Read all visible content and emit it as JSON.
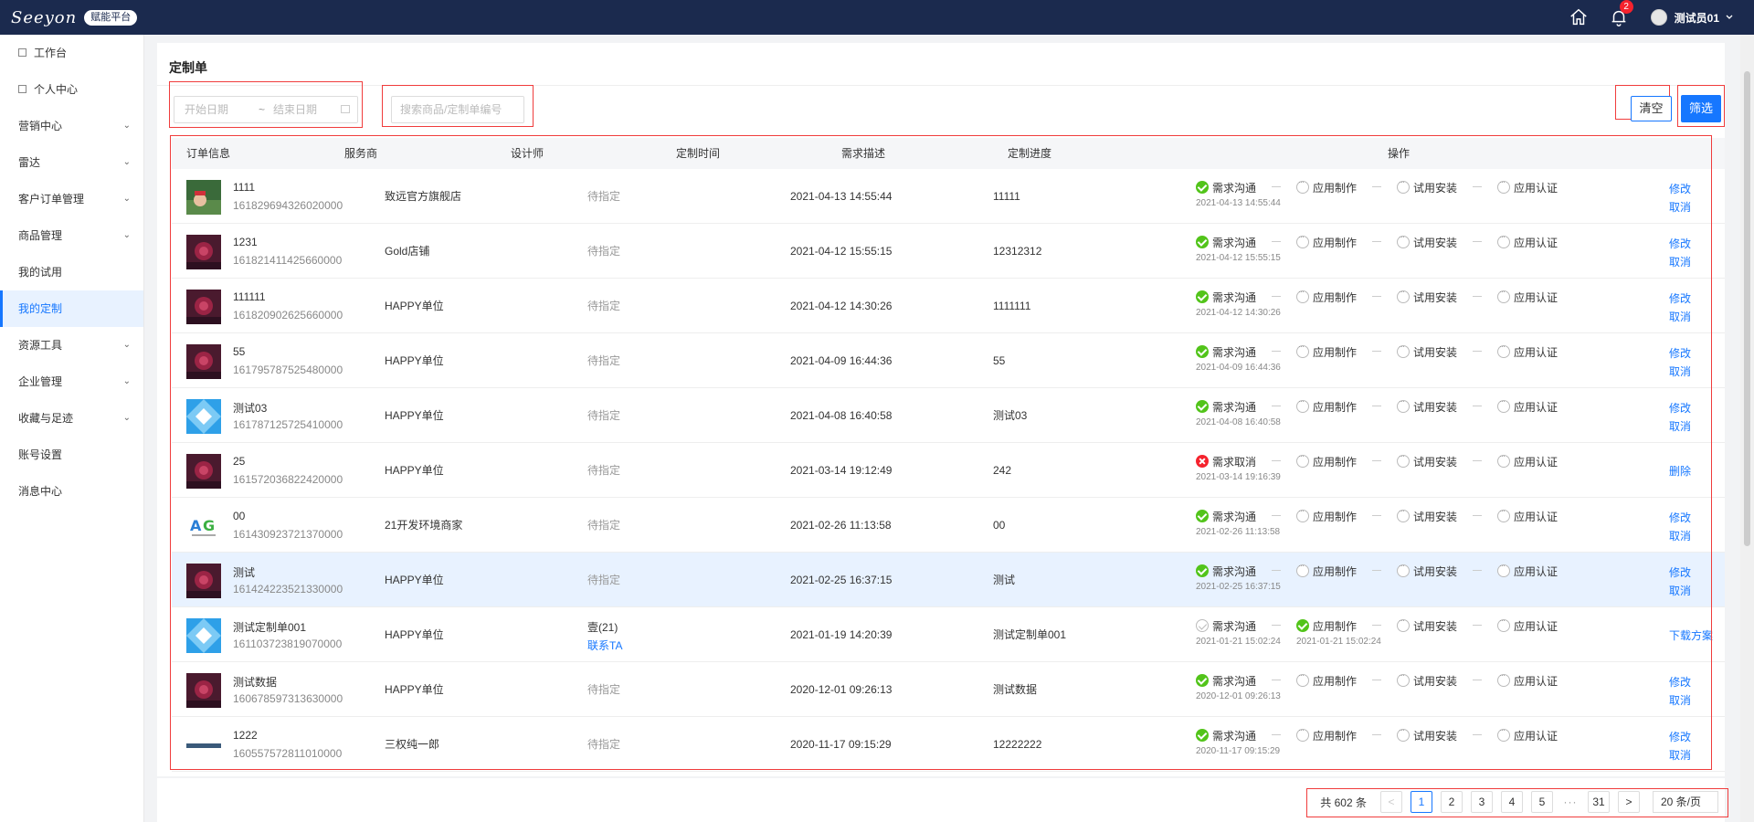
{
  "topbar": {
    "logo_text": "Seeyon",
    "logo_badge": "赋能平台",
    "notification_count": "2",
    "username": "测试员01"
  },
  "sidebar": {
    "items": [
      {
        "label": "工作台",
        "icon": "box-icon",
        "chevron": false,
        "active": false
      },
      {
        "label": "个人中心",
        "icon": "box-icon",
        "chevron": false,
        "active": false
      },
      {
        "label": "营销中心",
        "chevron": true,
        "active": false
      },
      {
        "label": "雷达",
        "chevron": true,
        "active": false
      },
      {
        "label": "客户订单管理",
        "chevron": true,
        "active": false
      },
      {
        "label": "商品管理",
        "chevron": true,
        "active": false
      },
      {
        "label": "我的试用",
        "chevron": false,
        "active": false
      },
      {
        "label": "我的定制",
        "chevron": false,
        "active": true
      },
      {
        "label": "资源工具",
        "chevron": true,
        "active": false
      },
      {
        "label": "企业管理",
        "chevron": true,
        "active": false
      },
      {
        "label": "收藏与足迹",
        "chevron": true,
        "active": false
      },
      {
        "label": "账号设置",
        "chevron": false,
        "active": false
      },
      {
        "label": "消息中心",
        "chevron": false,
        "active": false
      }
    ]
  },
  "page": {
    "title": "定制单",
    "date_start_placeholder": "开始日期",
    "date_separator": "~",
    "date_end_placeholder": "结束日期",
    "search_placeholder": "搜索商品/定制单编号",
    "clear_label": "清空",
    "filter_label": "筛选"
  },
  "table": {
    "headers": [
      "订单信息",
      "服务商",
      "设计师",
      "定制时间",
      "需求描述",
      "定制进度",
      "操作"
    ],
    "rows": [
      {
        "name": "1111",
        "no": "161829694326020000",
        "provider": "致远官方旗舰店",
        "designer": "待指定",
        "designer_link": "",
        "time": "2021-04-13 14:55:44",
        "desc": "11111",
        "thumb": "photo",
        "steps": [
          {
            "label": "需求沟通",
            "state": "done",
            "time": "2021-04-13 14:55:44"
          },
          {
            "label": "应用制作",
            "state": "pending",
            "time": ""
          },
          {
            "label": "试用安装",
            "state": "pending",
            "time": ""
          },
          {
            "label": "应用认证",
            "state": "pending",
            "time": ""
          }
        ],
        "ops": [
          "修改",
          "取消"
        ],
        "highlight": false
      },
      {
        "name": "1231",
        "no": "161821411425660000",
        "provider": "Gold店铺",
        "designer": "待指定",
        "designer_link": "",
        "time": "2021-04-12 15:55:15",
        "desc": "12312312",
        "thumb": "rose",
        "steps": [
          {
            "label": "需求沟通",
            "state": "done",
            "time": "2021-04-12 15:55:15"
          },
          {
            "label": "应用制作",
            "state": "pending",
            "time": ""
          },
          {
            "label": "试用安装",
            "state": "pending",
            "time": ""
          },
          {
            "label": "应用认证",
            "state": "pending",
            "time": ""
          }
        ],
        "ops": [
          "修改",
          "取消"
        ],
        "highlight": false
      },
      {
        "name": "111111",
        "no": "161820902625660000",
        "provider": "HAPPY单位",
        "designer": "待指定",
        "designer_link": "",
        "time": "2021-04-12 14:30:26",
        "desc": "1111111",
        "thumb": "rose",
        "steps": [
          {
            "label": "需求沟通",
            "state": "done",
            "time": "2021-04-12 14:30:26"
          },
          {
            "label": "应用制作",
            "state": "pending",
            "time": ""
          },
          {
            "label": "试用安装",
            "state": "pending",
            "time": ""
          },
          {
            "label": "应用认证",
            "state": "pending",
            "time": ""
          }
        ],
        "ops": [
          "修改",
          "取消"
        ],
        "highlight": false
      },
      {
        "name": "55",
        "no": "161795787525480000",
        "provider": "HAPPY单位",
        "designer": "待指定",
        "designer_link": "",
        "time": "2021-04-09 16:44:36",
        "desc": "55",
        "thumb": "rose",
        "steps": [
          {
            "label": "需求沟通",
            "state": "done",
            "time": "2021-04-09 16:44:36"
          },
          {
            "label": "应用制作",
            "state": "pending",
            "time": ""
          },
          {
            "label": "试用安装",
            "state": "pending",
            "time": ""
          },
          {
            "label": "应用认证",
            "state": "pending",
            "time": ""
          }
        ],
        "ops": [
          "修改",
          "取消"
        ],
        "highlight": false
      },
      {
        "name": "测试03",
        "no": "161787125725410000",
        "provider": "HAPPY单位",
        "designer": "待指定",
        "designer_link": "",
        "time": "2021-04-08 16:40:58",
        "desc": "测试03",
        "thumb": "blue",
        "steps": [
          {
            "label": "需求沟通",
            "state": "done",
            "time": "2021-04-08 16:40:58"
          },
          {
            "label": "应用制作",
            "state": "pending",
            "time": ""
          },
          {
            "label": "试用安装",
            "state": "pending",
            "time": ""
          },
          {
            "label": "应用认证",
            "state": "pending",
            "time": ""
          }
        ],
        "ops": [
          "修改",
          "取消"
        ],
        "highlight": false
      },
      {
        "name": "25",
        "no": "161572036822420000",
        "provider": "HAPPY单位",
        "designer": "待指定",
        "designer_link": "",
        "time": "2021-03-14 19:12:49",
        "desc": "242",
        "thumb": "rose",
        "steps": [
          {
            "label": "需求取消",
            "state": "cancel",
            "time": "2021-03-14 19:16:39"
          },
          {
            "label": "应用制作",
            "state": "pending",
            "time": ""
          },
          {
            "label": "试用安装",
            "state": "pending",
            "time": ""
          },
          {
            "label": "应用认证",
            "state": "pending",
            "time": ""
          }
        ],
        "ops": [
          "删除"
        ],
        "highlight": false
      },
      {
        "name": "00",
        "no": "161430923721370000",
        "provider": "21开发环境商家",
        "designer": "待指定",
        "designer_link": "",
        "time": "2021-02-26 11:13:58",
        "desc": "00",
        "thumb": "logo",
        "steps": [
          {
            "label": "需求沟通",
            "state": "done",
            "time": "2021-02-26 11:13:58"
          },
          {
            "label": "应用制作",
            "state": "pending",
            "time": ""
          },
          {
            "label": "试用安装",
            "state": "pending",
            "time": ""
          },
          {
            "label": "应用认证",
            "state": "pending",
            "time": ""
          }
        ],
        "ops": [
          "修改",
          "取消"
        ],
        "highlight": false
      },
      {
        "name": "测试",
        "no": "161424223521330000",
        "provider": "HAPPY单位",
        "designer": "待指定",
        "designer_link": "",
        "time": "2021-02-25 16:37:15",
        "desc": "测试",
        "thumb": "rose",
        "steps": [
          {
            "label": "需求沟通",
            "state": "done",
            "time": "2021-02-25 16:37:15"
          },
          {
            "label": "应用制作",
            "state": "pending",
            "time": ""
          },
          {
            "label": "试用安装",
            "state": "pending",
            "time": ""
          },
          {
            "label": "应用认证",
            "state": "pending",
            "time": ""
          }
        ],
        "ops": [
          "修改",
          "取消"
        ],
        "highlight": true
      },
      {
        "name": "测试定制单001",
        "no": "161103723819070000",
        "provider": "HAPPY单位",
        "designer": "壹(21)",
        "designer_link": "联系TA",
        "time": "2021-01-19 14:20:39",
        "desc": "测试定制单001",
        "thumb": "blue",
        "steps": [
          {
            "label": "需求沟通",
            "state": "hollow",
            "time": "2021-01-21 15:02:24"
          },
          {
            "label": "应用制作",
            "state": "done",
            "time": "2021-01-21 15:02:24"
          },
          {
            "label": "试用安装",
            "state": "pending",
            "time": ""
          },
          {
            "label": "应用认证",
            "state": "pending",
            "time": ""
          }
        ],
        "ops": [
          "下载方案"
        ],
        "highlight": false
      },
      {
        "name": "测试数据",
        "no": "160678597313630000",
        "provider": "HAPPY单位",
        "designer": "待指定",
        "designer_link": "",
        "time": "2020-12-01 09:26:13",
        "desc": "测试数据",
        "thumb": "rose",
        "steps": [
          {
            "label": "需求沟通",
            "state": "done",
            "time": "2020-12-01 09:26:13"
          },
          {
            "label": "应用制作",
            "state": "pending",
            "time": ""
          },
          {
            "label": "试用安装",
            "state": "pending",
            "time": ""
          },
          {
            "label": "应用认证",
            "state": "pending",
            "time": ""
          }
        ],
        "ops": [
          "修改",
          "取消"
        ],
        "highlight": false
      },
      {
        "name": "1222",
        "no": "160557572811010000",
        "provider": "三权纯一郎",
        "designer": "待指定",
        "designer_link": "",
        "time": "2020-11-17 09:15:29",
        "desc": "12222222",
        "thumb": "strip",
        "steps": [
          {
            "label": "需求沟通",
            "state": "done",
            "time": "2020-11-17 09:15:29"
          },
          {
            "label": "应用制作",
            "state": "pending",
            "time": ""
          },
          {
            "label": "试用安装",
            "state": "pending",
            "time": ""
          },
          {
            "label": "应用认证",
            "state": "pending",
            "time": ""
          }
        ],
        "ops": [
          "修改",
          "取消"
        ],
        "highlight": false
      }
    ]
  },
  "pagination": {
    "total": "共 602 条",
    "prev": "<",
    "pages": [
      "1",
      "2",
      "3",
      "4",
      "5"
    ],
    "ellipsis": "···",
    "last": "31",
    "next": ">",
    "page_size": "20 条/页",
    "current": "1"
  }
}
